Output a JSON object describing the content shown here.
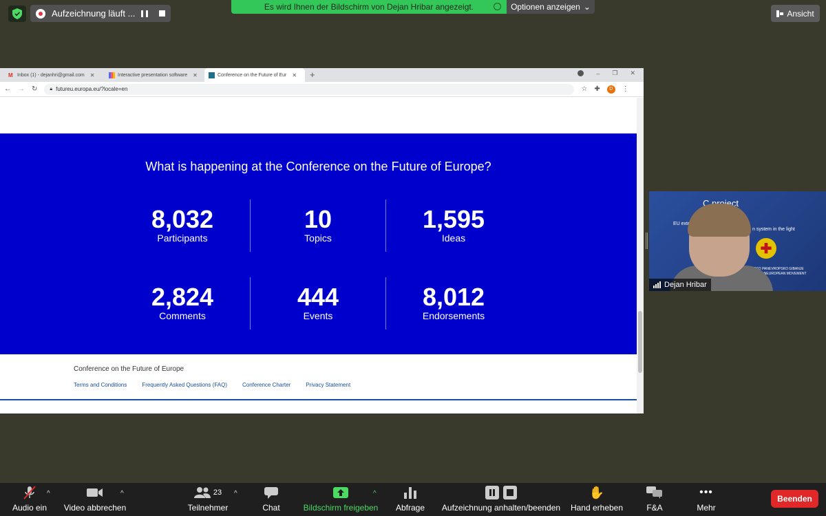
{
  "meeting": {
    "recording_label": "Aufzeichnung läuft ...",
    "share_banner": "Es wird Ihnen der Bildschirm von Dejan Hribar angezeigt.",
    "options_label": "Optionen anzeigen",
    "view_label": "Ansicht"
  },
  "browser": {
    "tabs": [
      {
        "label": "Inbox (1) - dejanhri@gmail.com",
        "icon": "gmail-icon"
      },
      {
        "label": "Interactive presentation software",
        "icon": "chart-favicon"
      },
      {
        "label": "Conference on the Future of Eur",
        "icon": "eu-favicon"
      }
    ],
    "url": "futureu.europa.eu/?locale=en",
    "profile_initial": "D"
  },
  "page": {
    "heading": "What is happening at the Conference on the Future of Europe?",
    "stats": [
      {
        "value": "8,032",
        "label": "Participants"
      },
      {
        "value": "10",
        "label": "Topics"
      },
      {
        "value": "1,595",
        "label": "Ideas"
      },
      {
        "value": "2,824",
        "label": "Comments"
      },
      {
        "value": "444",
        "label": "Events"
      },
      {
        "value": "8,012",
        "label": "Endorsements"
      }
    ],
    "footer": {
      "title": "Conference on the Future of Europe",
      "links": [
        "Terms and Conditions",
        "Frequently Asked Questions (FAQ)",
        "Conference Charter",
        "Privacy Statement"
      ]
    }
  },
  "video": {
    "participant_name": "Dejan Hribar",
    "slide_title": "C        project",
    "slide_line1": "EU exte",
    "slide_line2": "n system in the light",
    "slide_line3": "SKO PANEVROPSKO GIBANJE",
    "slide_line4": "AN PANEUROPEAN MOVEMENT"
  },
  "toolbar": {
    "audio": "Audio ein",
    "video": "Video abbrechen",
    "participants": "Teilnehmer",
    "participants_count": "23",
    "chat": "Chat",
    "share": "Bildschirm freigeben",
    "poll": "Abfrage",
    "recording": "Aufzeichnung anhalten/beenden",
    "raise_hand": "Hand erheben",
    "qa": "F&A",
    "more": "Mehr",
    "end": "Beenden"
  },
  "colors": {
    "hero_blue": "#0000cc",
    "share_green": "#33c759",
    "end_red": "#e02828",
    "link_blue": "#1a4ea0"
  }
}
